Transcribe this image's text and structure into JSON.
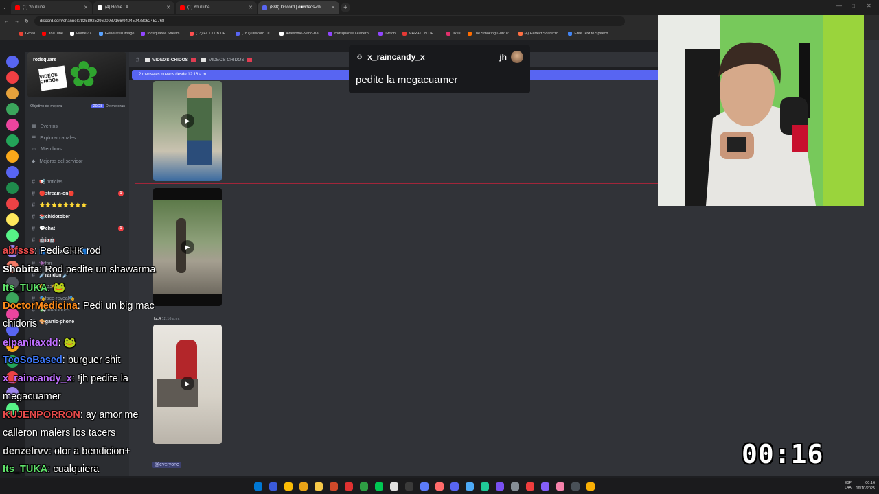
{
  "browser": {
    "tabs": [
      {
        "label": "(1) YouTube",
        "color": "#ff0000"
      },
      {
        "label": "(4) Home / X",
        "color": "#ffffff"
      },
      {
        "label": "(1) YouTube",
        "color": "#ff0000"
      },
      {
        "label": "(888) Discord | #■videos-chi…",
        "color": "#5865f2"
      }
    ],
    "url": "discord.com/channels/825892529600987166/940450478062452768",
    "bookmarks": [
      "Gmail",
      "YouTube",
      "Home / X",
      "Generated image",
      "rodsquaree Stream...",
      "(13) EL CLUB DE...",
      "(787) Discord | #...",
      "Awesome-Nano-Ba...",
      "rodsquaree Leader8...",
      "Twitch",
      "MARATON DE L...",
      "Ilkes",
      "The Smoking Gun: P...",
      "(4) Perfect Scarecro...",
      "Free Text to Speech..."
    ]
  },
  "discord": {
    "server_name": "rodsquare",
    "server_logo_text": "VIDEOS CHIDOS",
    "goal_label": "Objetivo de mejora",
    "goal_value": "20/28",
    "goal_suffix": "De mejoras",
    "menu": [
      "Eventos",
      "Explorar canales",
      "Miembros",
      "Mejoras del servidor"
    ],
    "channels": [
      {
        "name": "📢 noticias",
        "bright": false
      },
      {
        "name": "🔴stream-on🔴",
        "bright": true,
        "badge": "1"
      },
      {
        "name": "⭐⭐⭐⭐⭐⭐⭐⭐",
        "bright": true
      },
      {
        "name": "📚chidotober",
        "bright": true
      },
      {
        "name": "💬chat",
        "bright": true,
        "badge": "1"
      },
      {
        "name": "🤖ia🤖",
        "bright": true
      },
      {
        "name": "🟦TERROR-CHIDO🟦",
        "bright": true
      },
      {
        "name": "👾fan",
        "bright": false
      },
      {
        "name": "☄️random☄️",
        "bright": true
      },
      {
        "name": "😀rod😀",
        "bright": false
      },
      {
        "name": "🎭face-reveal🎭",
        "bright": false
      },
      {
        "name": "💸donaciones",
        "bright": false
      },
      {
        "name": "🎨gartic-phone",
        "bright": true
      }
    ],
    "header_channels": [
      "VIDEOS-CHIDOS",
      "VIDEOS CHIDOS"
    ],
    "new_messages_banner": "2 mensajes nuevos desde 12:16 a.m.",
    "message_author": "luc4",
    "message_time": "12:16 a.m.",
    "mention": "@everyone"
  },
  "alert": {
    "username": "x_raincandy_x",
    "tag": "jh",
    "message": "pedite la megacuamer"
  },
  "stream_chat": [
    {
      "name": "abfsss",
      "color": "#e84b4b",
      "text": "Pedi CHK rod"
    },
    {
      "name": "Shobita",
      "color": "#ffffff",
      "text": "Rod pedite un shawarma"
    },
    {
      "name": "Its_TUKA",
      "color": "#5fe36a",
      "text": "🐸"
    },
    {
      "name": "DoctorMedicina",
      "color": "#ff8c1a",
      "text": "Pedi un big mac"
    },
    {
      "name": "",
      "color": "#ffffff",
      "text": "chidoris"
    },
    {
      "name": "elpanitaxdd",
      "color": "#c070ff",
      "text": "🐸"
    },
    {
      "name": "TeoSoBased",
      "color": "#3f7bff",
      "text": "burguer shit"
    },
    {
      "name": "x_raincandy_x",
      "color": "#c070ff",
      "text": "!jh pedite la"
    },
    {
      "name": "",
      "color": "#ffffff",
      "text": "megacuamer"
    },
    {
      "name": "KUJENPORRON",
      "color": "#e84b4b",
      "text": "ay amor me"
    },
    {
      "name": "",
      "color": "#ffffff",
      "text": "calleron malers los tacers"
    },
    {
      "name": "denzelrvv",
      "color": "#d8d8d8",
      "text": "olor a bendicion+"
    },
    {
      "name": "Its_TUKA",
      "color": "#5fe36a",
      "text": "cualquiera"
    }
  ],
  "timer": "00:16",
  "taskbar": {
    "lang": "ESP",
    "lang2": "LAA",
    "time": "00:16",
    "date": "16/10/2025"
  }
}
